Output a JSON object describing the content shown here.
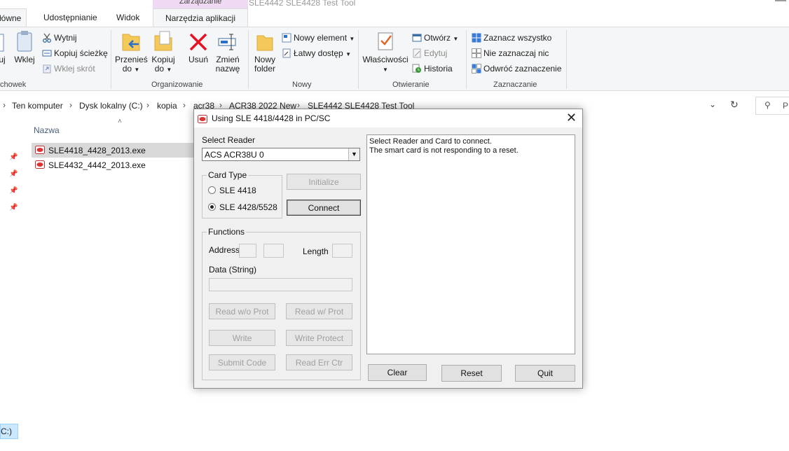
{
  "explorer": {
    "window_title": "SLE4442 SLE4428 Test Tool",
    "context_group": "Zarządzanie",
    "tabs": [
      "łówne",
      "Udostępnianie",
      "Widok",
      "Narzędzia aplikacji"
    ],
    "ribbon": {
      "clipboard": {
        "label": "chowek",
        "copy_partial": "uj",
        "paste": "Wklej",
        "cut": "Wytnij",
        "copy_path": "Kopiuj ścieżkę",
        "paste_shortcut": "Wklej skrót"
      },
      "organize": {
        "label": "Organizowanie",
        "move_to_1": "Przenieś",
        "move_to_2": "do",
        "copy_to_1": "Kopiuj",
        "copy_to_2": "do",
        "delete": "Usuń",
        "rename_1": "Zmień",
        "rename_2": "nazwę"
      },
      "new": {
        "label": "Nowy",
        "new_folder_1": "Nowy",
        "new_folder_2": "folder",
        "new_item": "Nowy element",
        "easy_access": "Łatwy dostęp"
      },
      "open": {
        "label": "Otwieranie",
        "properties": "Właściwości",
        "open": "Otwórz",
        "edit": "Edytuj",
        "history": "Historia"
      },
      "select": {
        "label": "Zaznaczanie",
        "select_all": "Zaznacz wszystko",
        "select_none": "Nie zaznaczaj nic",
        "invert": "Odwróć zaznaczenie"
      }
    },
    "breadcrumbs": [
      "Ten komputer",
      "Dysk lokalny (C:)",
      "kopia",
      "acr38",
      "ACR38 2022 New",
      "SLE4442 SLE4428 Test Tool"
    ],
    "search_prefix": "P",
    "column_name": "Nazwa",
    "files": [
      "SLE4418_4428_2013.exe",
      "SLE4432_4442_2013.exe"
    ],
    "drive_label": "C:)"
  },
  "dialog": {
    "title": "Using SLE 4418/4428 in PC/SC",
    "select_reader_label": "Select Reader",
    "reader_value": "ACS ACR38U 0",
    "card_type_label": "Card Type",
    "card_types": [
      "SLE 4418",
      "SLE 4428/5528"
    ],
    "selected_card_type": "SLE 4428/5528",
    "initialize": "Initialize",
    "connect": "Connect",
    "functions_label": "Functions",
    "address_label": "Address",
    "length_label": "Length",
    "data_label": "Data (String)",
    "buttons": {
      "read_no_prot": "Read w/o Prot",
      "read_prot": "Read w/ Prot",
      "write": "Write",
      "write_protect": "Write Protect",
      "submit_code": "Submit Code",
      "read_err_ctr": "Read Err Ctr",
      "clear": "Clear",
      "reset": "Reset",
      "quit": "Quit"
    },
    "log_lines": [
      "Select Reader and Card to connect.",
      "The smart card is not responding to a reset."
    ]
  },
  "icons": [
    "scissors-icon",
    "copy-path-icon",
    "paste-shortcut-icon",
    "clipboard-icon",
    "move-to-icon",
    "copy-to-icon",
    "delete-icon",
    "rename-icon",
    "new-folder-icon",
    "new-item-icon",
    "easy-access-icon",
    "properties-icon",
    "open-icon",
    "edit-icon",
    "history-icon",
    "select-all-icon",
    "select-none-icon",
    "invert-selection-icon",
    "pin-icon",
    "exe-icon",
    "search-icon",
    "refresh-icon",
    "chevron-down-icon",
    "close-icon"
  ],
  "colors": {
    "accent": "#0063b1",
    "delete": "#e81123",
    "context_tab": "#f0daf3",
    "selection": "#d9d9d9"
  }
}
